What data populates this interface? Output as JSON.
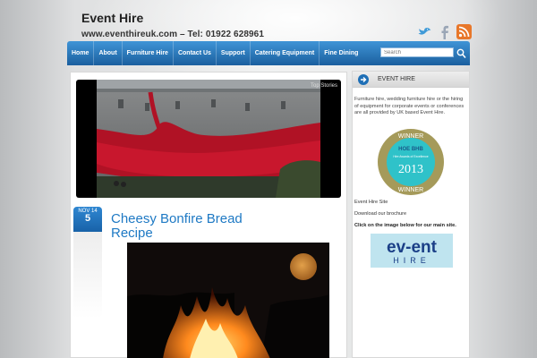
{
  "header": {
    "site_title": "Event Hire",
    "tagline": "www.eventhireuk.com – Tel: 01922 628961"
  },
  "social": [
    {
      "icon": "twitter-bird-icon"
    },
    {
      "icon": "facebook-icon"
    },
    {
      "icon": "rss-icon"
    }
  ],
  "nav": {
    "items": [
      "Home",
      "About",
      "Furniture Hire",
      "Contact Us",
      "Support",
      "Catering Equipment",
      "Fine Dining"
    ],
    "search_placeholder": "Search"
  },
  "slider": {
    "label": "Top Stories"
  },
  "post": {
    "month": "NOV 14",
    "day": "5",
    "title": "Cheesy Bonfire Bread Recipe"
  },
  "sidebar": {
    "title": "EVENT HIRE",
    "description": "Furniture hire, wedding furniture hire or the hiring of equipment for corporate events or conferences are all provided by UK based Event Hire.",
    "award": {
      "top": "WINNER",
      "brand": "HOE BHB",
      "caption": "Hire Awards of Excellence",
      "year": "2013",
      "bottom": "WINNER"
    },
    "link_site": "Event Hire Site",
    "link_brochure": "Download our brochure",
    "click_text": "Click on the image below for our main site.",
    "logo_main": "ev-ent",
    "logo_sub": "HIRE"
  },
  "colors": {
    "nav_blue": "#1b5f9f",
    "title_blue": "#1e79c4",
    "award_gold": "#a59a5a",
    "award_teal": "#2fc2c9",
    "logo_navy": "#1b3f87"
  }
}
